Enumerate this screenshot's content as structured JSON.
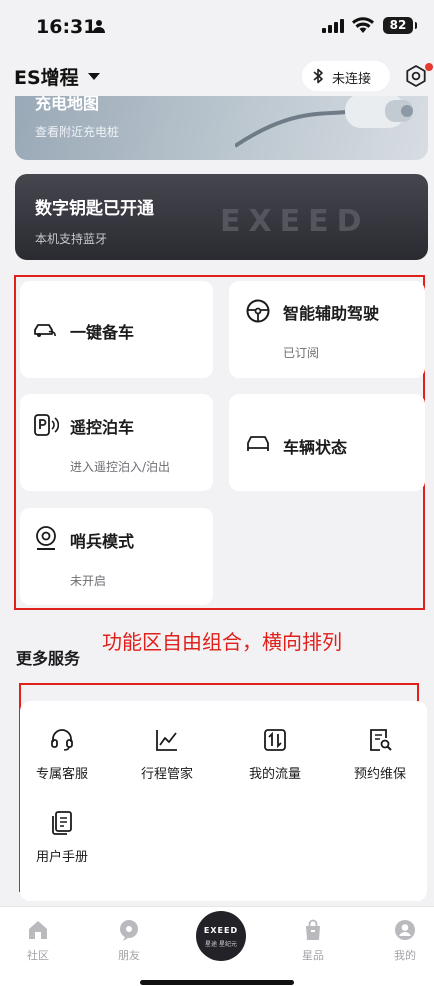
{
  "status_bar": {
    "time": "16:31",
    "battery": "82"
  },
  "header": {
    "vehicle_name": "ES增程",
    "bluetooth_status": "未连接"
  },
  "charge_card": {
    "title": "充电地图",
    "subtitle": "查看附近充电桩"
  },
  "key_card": {
    "title": "数字钥匙已开通",
    "subtitle": "本机支持蓝牙",
    "brand": "EXEED"
  },
  "functions": {
    "one_key_prep": {
      "label": "一键备车"
    },
    "smart_assist": {
      "label": "智能辅助驾驶",
      "status": "已订阅"
    },
    "remote_parking": {
      "label": "遥控泊车",
      "status": "进入遥控泊入/泊出"
    },
    "vehicle_status": {
      "label": "车辆状态"
    },
    "sentry_mode": {
      "label": "哨兵模式",
      "status": "未开启"
    }
  },
  "annotation": "功能区自由组合，横向排列",
  "more_services": {
    "title": "更多服务",
    "items": [
      {
        "label": "专属客服",
        "icon": "headset-icon"
      },
      {
        "label": "行程管家",
        "icon": "trend-chart-icon"
      },
      {
        "label": "我的流量",
        "icon": "data-transfer-icon"
      },
      {
        "label": "预约维保",
        "icon": "maintenance-icon"
      },
      {
        "label": "用户手册",
        "icon": "manual-icon"
      }
    ]
  },
  "tabbar": {
    "items": [
      {
        "label": "社区",
        "icon": "home-icon"
      },
      {
        "label": "朋友",
        "icon": "chat-icon"
      },
      {
        "label": "",
        "icon": "brand-logo-icon"
      },
      {
        "label": "星品",
        "icon": "shopping-bag-icon"
      },
      {
        "label": "我的",
        "icon": "profile-icon"
      }
    ],
    "center_logo": "EXEED",
    "center_sub": "星途 星纪元"
  },
  "colors": {
    "accent_red": "#e0201b",
    "notification_dot": "#e53a2e",
    "key_card_bg": "#2a2a31"
  }
}
